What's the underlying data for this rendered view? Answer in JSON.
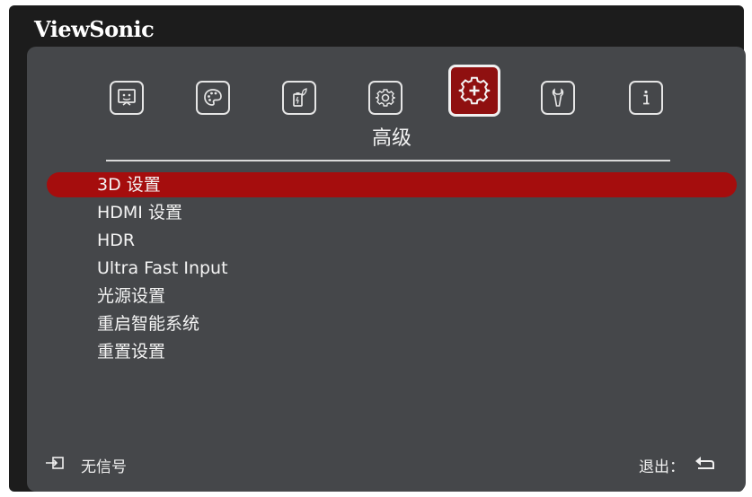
{
  "brand": "ViewSonic",
  "tabs": [
    {
      "name": "display-icon"
    },
    {
      "name": "palette-icon"
    },
    {
      "name": "power-eco-icon"
    },
    {
      "name": "advanced-gear-icon",
      "active": true
    },
    {
      "name": "tools-wrench-icon"
    },
    {
      "name": "info-icon"
    }
  ],
  "active_tab_label": "高级",
  "menu": {
    "items": [
      {
        "label": "3D 设置",
        "selected": true
      },
      {
        "label": "HDMI 设置"
      },
      {
        "label": "HDR"
      },
      {
        "label": "Ultra Fast Input"
      },
      {
        "label": "光源设置"
      },
      {
        "label": "重启智能系统"
      },
      {
        "label": "重置设置"
      }
    ]
  },
  "footer": {
    "source_status": "无信号",
    "exit_label": "退出："
  },
  "colors": {
    "frame": "#1c1c1c",
    "panel": "#45474a",
    "highlight": "#a50d0d",
    "active_tab": "#8f1010",
    "text": "#f4f4f4"
  }
}
